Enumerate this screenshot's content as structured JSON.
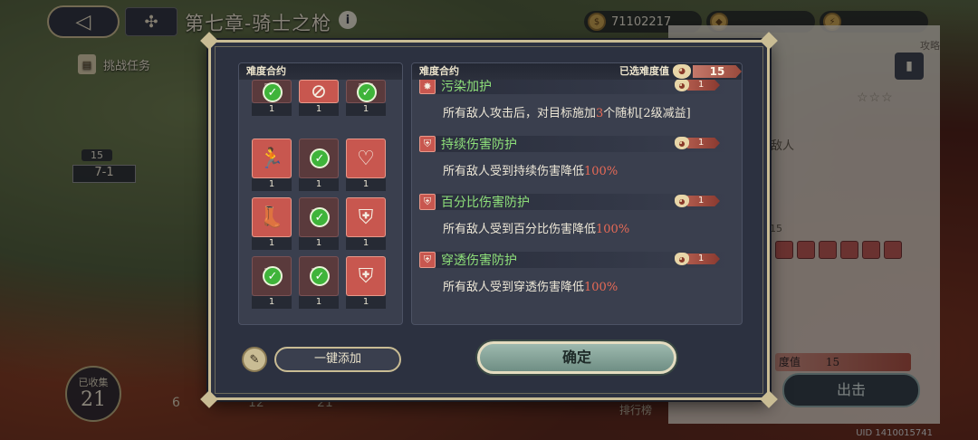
{
  "header": {
    "chapter_title": "第七章-骑士之枪",
    "info_icon": "info-icon",
    "currency": [
      {
        "icon": "coin-icon",
        "value": "71102217"
      },
      {
        "icon": "gem-icon",
        "value": ""
      },
      {
        "icon": "stamina-icon",
        "value": ""
      }
    ]
  },
  "map": {
    "challenge_task": "挑战任务",
    "stage": {
      "level": "15",
      "name": "7-1"
    },
    "collected_label": "已收集",
    "collected_count": "21",
    "bottom_numbers": [
      "6",
      "12",
      "21"
    ],
    "rank_label": "排行榜",
    "uid": "UID 1410015741"
  },
  "side_panel": {
    "label": "攻略",
    "enemy_text": "敌人",
    "difficulty_number": "15",
    "difficulty_label": "度值",
    "difficulty_value": "15",
    "go_button": "出击"
  },
  "modal": {
    "left_title": "难度合约",
    "right_title": "难度合约",
    "selected_label": "已选难度值",
    "selected_value": "15",
    "cards": [
      {
        "glyph": "⛨",
        "checked": true,
        "count": "1",
        "active": false,
        "partial": true
      },
      {
        "glyph": "⊘",
        "checked": false,
        "count": "1",
        "active": true,
        "partial": true
      },
      {
        "glyph": "⛨",
        "checked": true,
        "count": "1",
        "active": false,
        "partial": true
      },
      {
        "glyph": "🏃",
        "checked": false,
        "count": "1",
        "active": true
      },
      {
        "glyph": "✸",
        "checked": true,
        "count": "1",
        "active": false
      },
      {
        "glyph": "♡",
        "checked": false,
        "count": "1",
        "active": true
      },
      {
        "glyph": "👢",
        "checked": false,
        "count": "1",
        "active": true
      },
      {
        "glyph": "⛨",
        "checked": true,
        "count": "1",
        "active": false
      },
      {
        "glyph": "⛨",
        "checked": false,
        "count": "1",
        "active": true
      },
      {
        "glyph": "⛨",
        "checked": true,
        "count": "1",
        "active": false
      },
      {
        "glyph": "⛨",
        "checked": true,
        "count": "1",
        "active": false
      },
      {
        "glyph": "⛨",
        "checked": false,
        "count": "1",
        "active": true
      }
    ],
    "effects": [
      {
        "icon": "✸",
        "name": "污染加护",
        "value": "1",
        "desc_pre": "所有敌人攻击后，对目标施加",
        "desc_hl": "3",
        "desc_post": "个随机[2级减益]"
      },
      {
        "icon": "⛨",
        "name": "持续伤害防护",
        "value": "1",
        "desc_pre": "所有敌人受到持续伤害降低",
        "desc_hl": "100%",
        "desc_post": ""
      },
      {
        "icon": "⛨",
        "name": "百分比伤害防护",
        "value": "1",
        "desc_pre": "所有敌人受到百分比伤害降低",
        "desc_hl": "100%",
        "desc_post": ""
      },
      {
        "icon": "⛨",
        "name": "穿透伤害防护",
        "value": "1",
        "desc_pre": "所有敌人受到穿透伤害降低",
        "desc_hl": "100%",
        "desc_post": ""
      }
    ],
    "auto_add_label": "一键添加",
    "confirm_label": "确定"
  }
}
